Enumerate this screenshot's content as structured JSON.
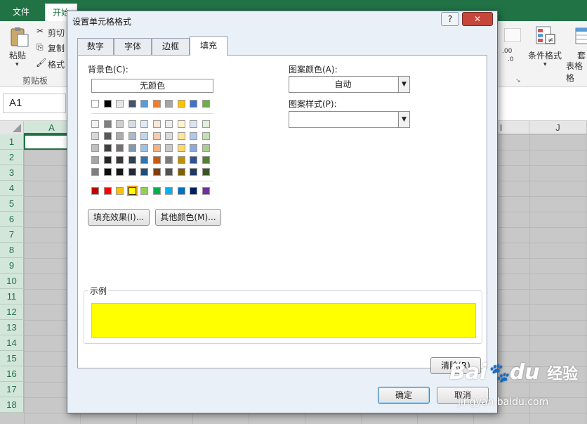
{
  "excel": {
    "tabs": [
      "文件",
      "开始"
    ],
    "ribbon": {
      "paste_label": "粘贴",
      "cut_label": "剪切",
      "copy_label": "复制",
      "format_painter_label": "格式",
      "clipboard_group": "剪贴板",
      "cond_format_label": "条件格式",
      "table_label_1": "套",
      "table_label_2": "表格格"
    },
    "name_box": "A1",
    "col_headers": [
      "A",
      "I",
      "J"
    ],
    "row_headers": [
      "1",
      "2",
      "3",
      "4",
      "5",
      "6",
      "7",
      "8",
      "9",
      "10",
      "11",
      "12",
      "13",
      "14",
      "15",
      "16",
      "17",
      "18"
    ]
  },
  "dialog": {
    "title": "设置单元格格式",
    "help_button": "?",
    "close_button": "✕",
    "tabs": [
      "数字",
      "字体",
      "边框",
      "填充"
    ],
    "active_tab": "填充",
    "background_color_label": "背景色(C):",
    "no_color_button": "无颜色",
    "fill_effects_button": "填充效果(I)...",
    "more_colors_button": "其他颜色(M)...",
    "pattern_color_label": "图案颜色(A):",
    "pattern_color_value": "自动",
    "pattern_style_label": "图案样式(P):",
    "pattern_style_value": "",
    "sample_label": "示例",
    "sample_color": "#FFFF00",
    "clear_button": "清除(R)",
    "ok_button": "确定",
    "cancel_button": "取消",
    "theme_row": [
      "#FFFFFF",
      "#000000",
      "#E7E6E6",
      "#44546A",
      "#5B9BD5",
      "#ED7D31",
      "#A5A5A5",
      "#FFC000",
      "#4472C4",
      "#70AD47"
    ],
    "tint_rows": [
      [
        "#F2F2F2",
        "#7F7F7F",
        "#D0CECE",
        "#D6DCE4",
        "#DEEBF6",
        "#FBE5D5",
        "#EDEDED",
        "#FFF2CC",
        "#DAE3F3",
        "#E2EFD9"
      ],
      [
        "#D8D8D8",
        "#595959",
        "#AEABAB",
        "#ADB9CA",
        "#BDD7EE",
        "#F7CBAC",
        "#DBDBDB",
        "#FEE599",
        "#B4C6E7",
        "#C5E0B3"
      ],
      [
        "#BFBFBF",
        "#3F3F3F",
        "#757070",
        "#8496B0",
        "#9CC3E5",
        "#F4B183",
        "#C9C9C9",
        "#FFD965",
        "#8EAADB",
        "#A8D08D"
      ],
      [
        "#A5A5A5",
        "#262626",
        "#3A3838",
        "#323F4F",
        "#2E75B5",
        "#C55A11",
        "#7B7B7B",
        "#BF9000",
        "#2F5496",
        "#538135"
      ],
      [
        "#7F7F7F",
        "#0C0C0C",
        "#171616",
        "#222A35",
        "#1E4E79",
        "#833C0B",
        "#525252",
        "#7F6000",
        "#1F3864",
        "#375623"
      ]
    ],
    "standard_row": [
      "#C00000",
      "#FF0000",
      "#FFC000",
      "#FFFF00",
      "#92D050",
      "#00B050",
      "#00B0F0",
      "#0070C0",
      "#002060",
      "#7030A0"
    ],
    "selected_color": "#FFFF00"
  },
  "watermark": {
    "brand": "Bai",
    "brand2": "du",
    "suffix": "经验",
    "url": "jingyan.baidu.com"
  }
}
